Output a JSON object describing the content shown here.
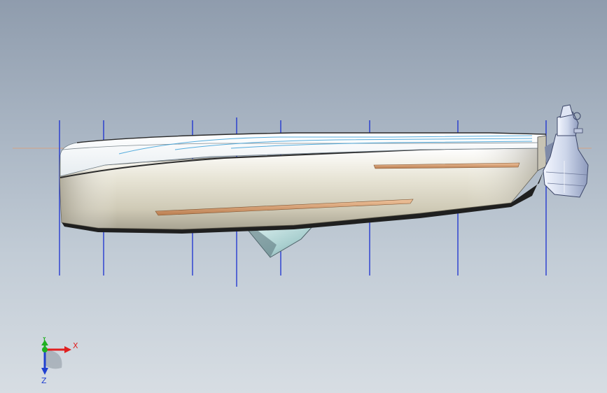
{
  "triad": {
    "x_label": "X",
    "y_label": "Y",
    "z_label": "Z",
    "x_color": "#e02020",
    "y_color": "#20b020",
    "z_color": "#2040d0"
  },
  "colors": {
    "section_lines": "#1a2fd0",
    "accent_strip": "#d9a072",
    "hull_light": "#f2efe6",
    "hull_dark": "#2a2a2a"
  }
}
